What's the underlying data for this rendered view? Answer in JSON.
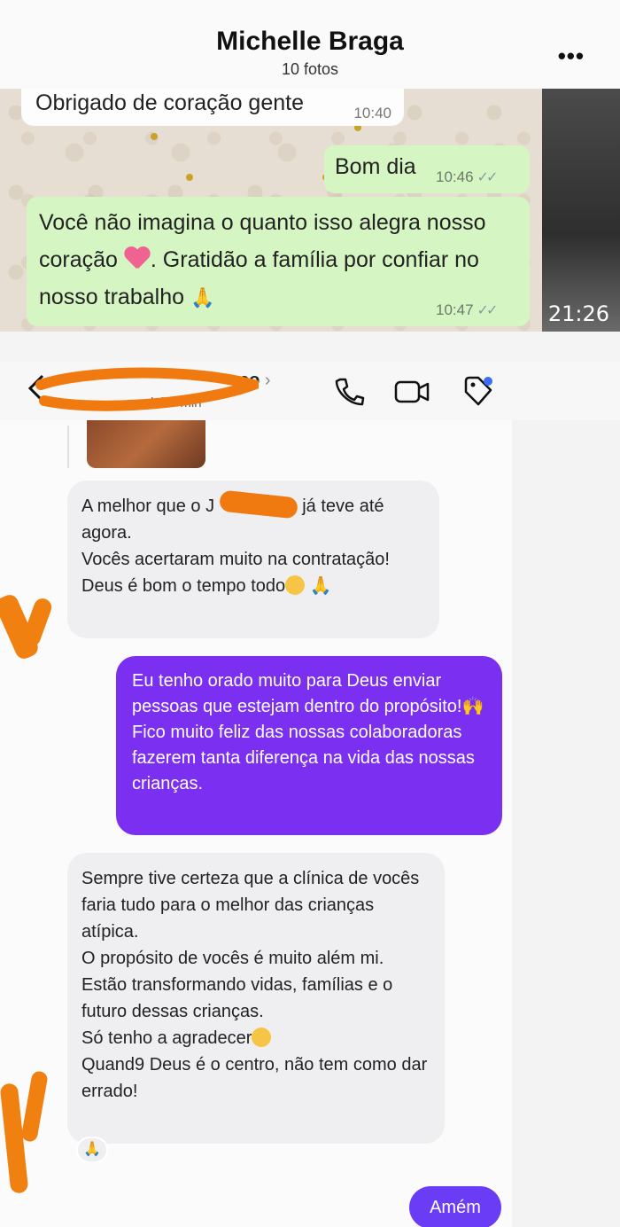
{
  "album": {
    "name": "Michelle Braga",
    "count": "10 fotos",
    "more_label": "•••"
  },
  "whatsapp": {
    "msg_in": {
      "text": "Obrigado de coração gente",
      "time": "10:40"
    },
    "msg_out_1": {
      "text": "Bom dia",
      "time": "10:46"
    },
    "msg_out_2": {
      "text_a": "Você não imagina o quanto isso alegra nosso coração",
      "text_b": ". Gratidão a família por confiar no nosso trabalho",
      "time": "10:47"
    },
    "video_duration": "21:26"
  },
  "instagram": {
    "header": {
      "contact_name": "co",
      "status": "há 9 min"
    },
    "messages": {
      "m1": {
        "a": "A melhor que o J",
        "b": "já teve até agora.",
        "c": "Vocês acertaram muito na contratação!",
        "d": "Deus é bom o tempo todo"
      },
      "m2": {
        "a": "Eu tenho orado muito para Deus enviar pessoas que estejam dentro do propósito!",
        "b": " Fico muito feliz das nossas colaboradoras fazerem tanta diferença na vida das nossas crianças."
      },
      "m3": {
        "a": "Sempre tive certeza que a clínica de vocês faria tudo para o melhor das crianças atípica.",
        "b": "O propósito de vocês é muito além mi.",
        "c": "Estão transformando vidas, famílias e o futuro dessas crianças.",
        "d": "Só tenho a agradecer",
        "e": "Quand9 Deus é o centro, não tem como dar errado!"
      },
      "m4": {
        "text": "Amém"
      }
    },
    "reaction": "🙏"
  },
  "colors": {
    "wa_out_bubble": "#d5f5c3",
    "ig_out_bubble": "#7b2ff0",
    "ig_in_bubble": "#efeff1",
    "redaction": "#f07a10"
  },
  "icons": [
    "more-icon",
    "back-icon",
    "phone-icon",
    "video-icon",
    "tag-icon",
    "heart-emoji",
    "pray-emoji",
    "pleading-emoji"
  ]
}
